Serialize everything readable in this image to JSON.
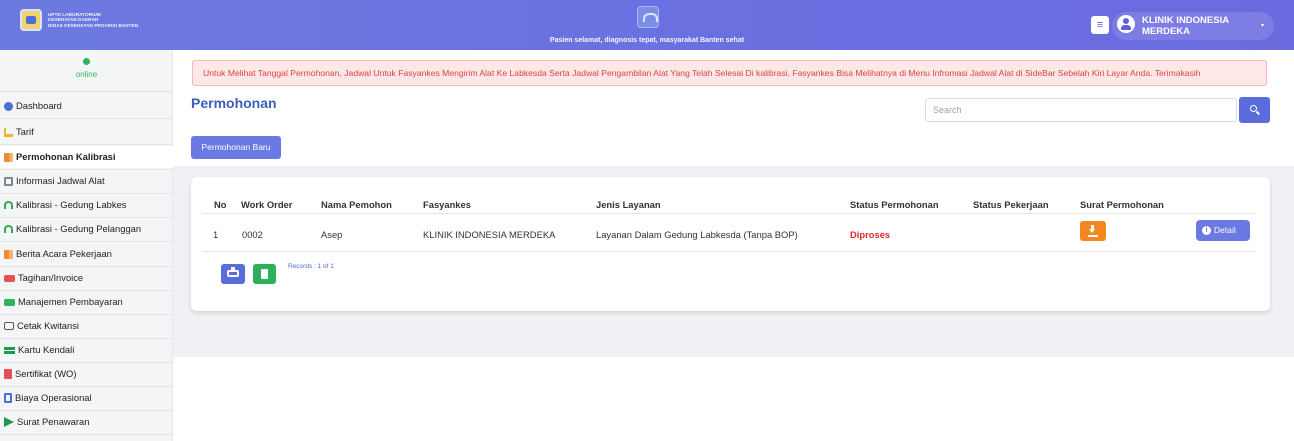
{
  "header": {
    "brand_lines": [
      "UPTD Laboratorium",
      "Kesehatan Daerah",
      "Dinas Kesehatan Provinsi Banten"
    ],
    "tagline": "Pasien selamat, diagnosis tepat, masyarakat Banten sehat",
    "menu_icon": "≡",
    "user_name": "KLINIK INDONESIA MERDEKA",
    "caret": "▾"
  },
  "sidebar": {
    "status": "online",
    "items": [
      {
        "label": "Dashboard",
        "icon": "dashboard-icon"
      },
      {
        "label": "Tarif",
        "icon": "tarif-icon"
      },
      {
        "label": "Permohonan Kalibrasi",
        "icon": "folder-icon"
      },
      {
        "label": "Informasi Jadwal Alat",
        "icon": "calendar-icon"
      },
      {
        "label": "Kalibrasi - Gedung Labkes",
        "icon": "gauge-icon"
      },
      {
        "label": "Kalibrasi - Gedung Pelanggan",
        "icon": "gauge-icon"
      },
      {
        "label": "Berita Acara Pekerjaan",
        "icon": "folder-icon"
      },
      {
        "label": "Tagihan/Invoice",
        "icon": "invoice-icon"
      },
      {
        "label": "Manajemen Pembayaran",
        "icon": "money-icon"
      },
      {
        "label": "Cetak Kwitansi",
        "icon": "print-icon"
      },
      {
        "label": "Kartu Kendali",
        "icon": "card-icon"
      },
      {
        "label": "Sertifikat (WO)",
        "icon": "certificate-icon"
      },
      {
        "label": "Biaya Operasional",
        "icon": "calculator-icon"
      },
      {
        "label": "Surat Penawaran",
        "icon": "send-icon"
      }
    ]
  },
  "main": {
    "alert": "Untuk Melihat Tanggal Permohonan, Jadwal Untuk Fasyankes Mengirim Alat Ke Labkesda Serta Jadwal Pengambilan Alat Yang Telah Selesai Di kalibrasi, Fasyankes Bisa Melihatnya di Menu Infromasi Jadwal Alat di SideBar Sebelah Kiri Layar Anda. Terimakasih",
    "title": "Permohonan",
    "search_placeholder": "Search",
    "new_button": "Permohonan Baru",
    "table": {
      "headers": [
        "No",
        "Work Order",
        "Nama Pemohon",
        "Fasyankes",
        "Jenis Layanan",
        "Status Permohonan",
        "Status Pekerjaan",
        "Surat Permohonan"
      ],
      "rows": [
        {
          "no": "1",
          "work_order": "0002",
          "nama_pemohon": "Asep",
          "fasyankes": "KLINIK INDONESIA MERDEKA",
          "jenis_layanan": "Layanan Dalam Gedung Labkesda (Tanpa BOP)",
          "status_permohonan": "Diproses",
          "status_pekerjaan": "",
          "detail_label": "Detail"
        }
      ]
    },
    "records": "Records : 1 of 1"
  },
  "colors": {
    "header": "#6b74e0",
    "accent": "#5b6cdc",
    "status_proses": "#e02a2a",
    "download": "#f2871f",
    "success": "#2eb05a"
  }
}
